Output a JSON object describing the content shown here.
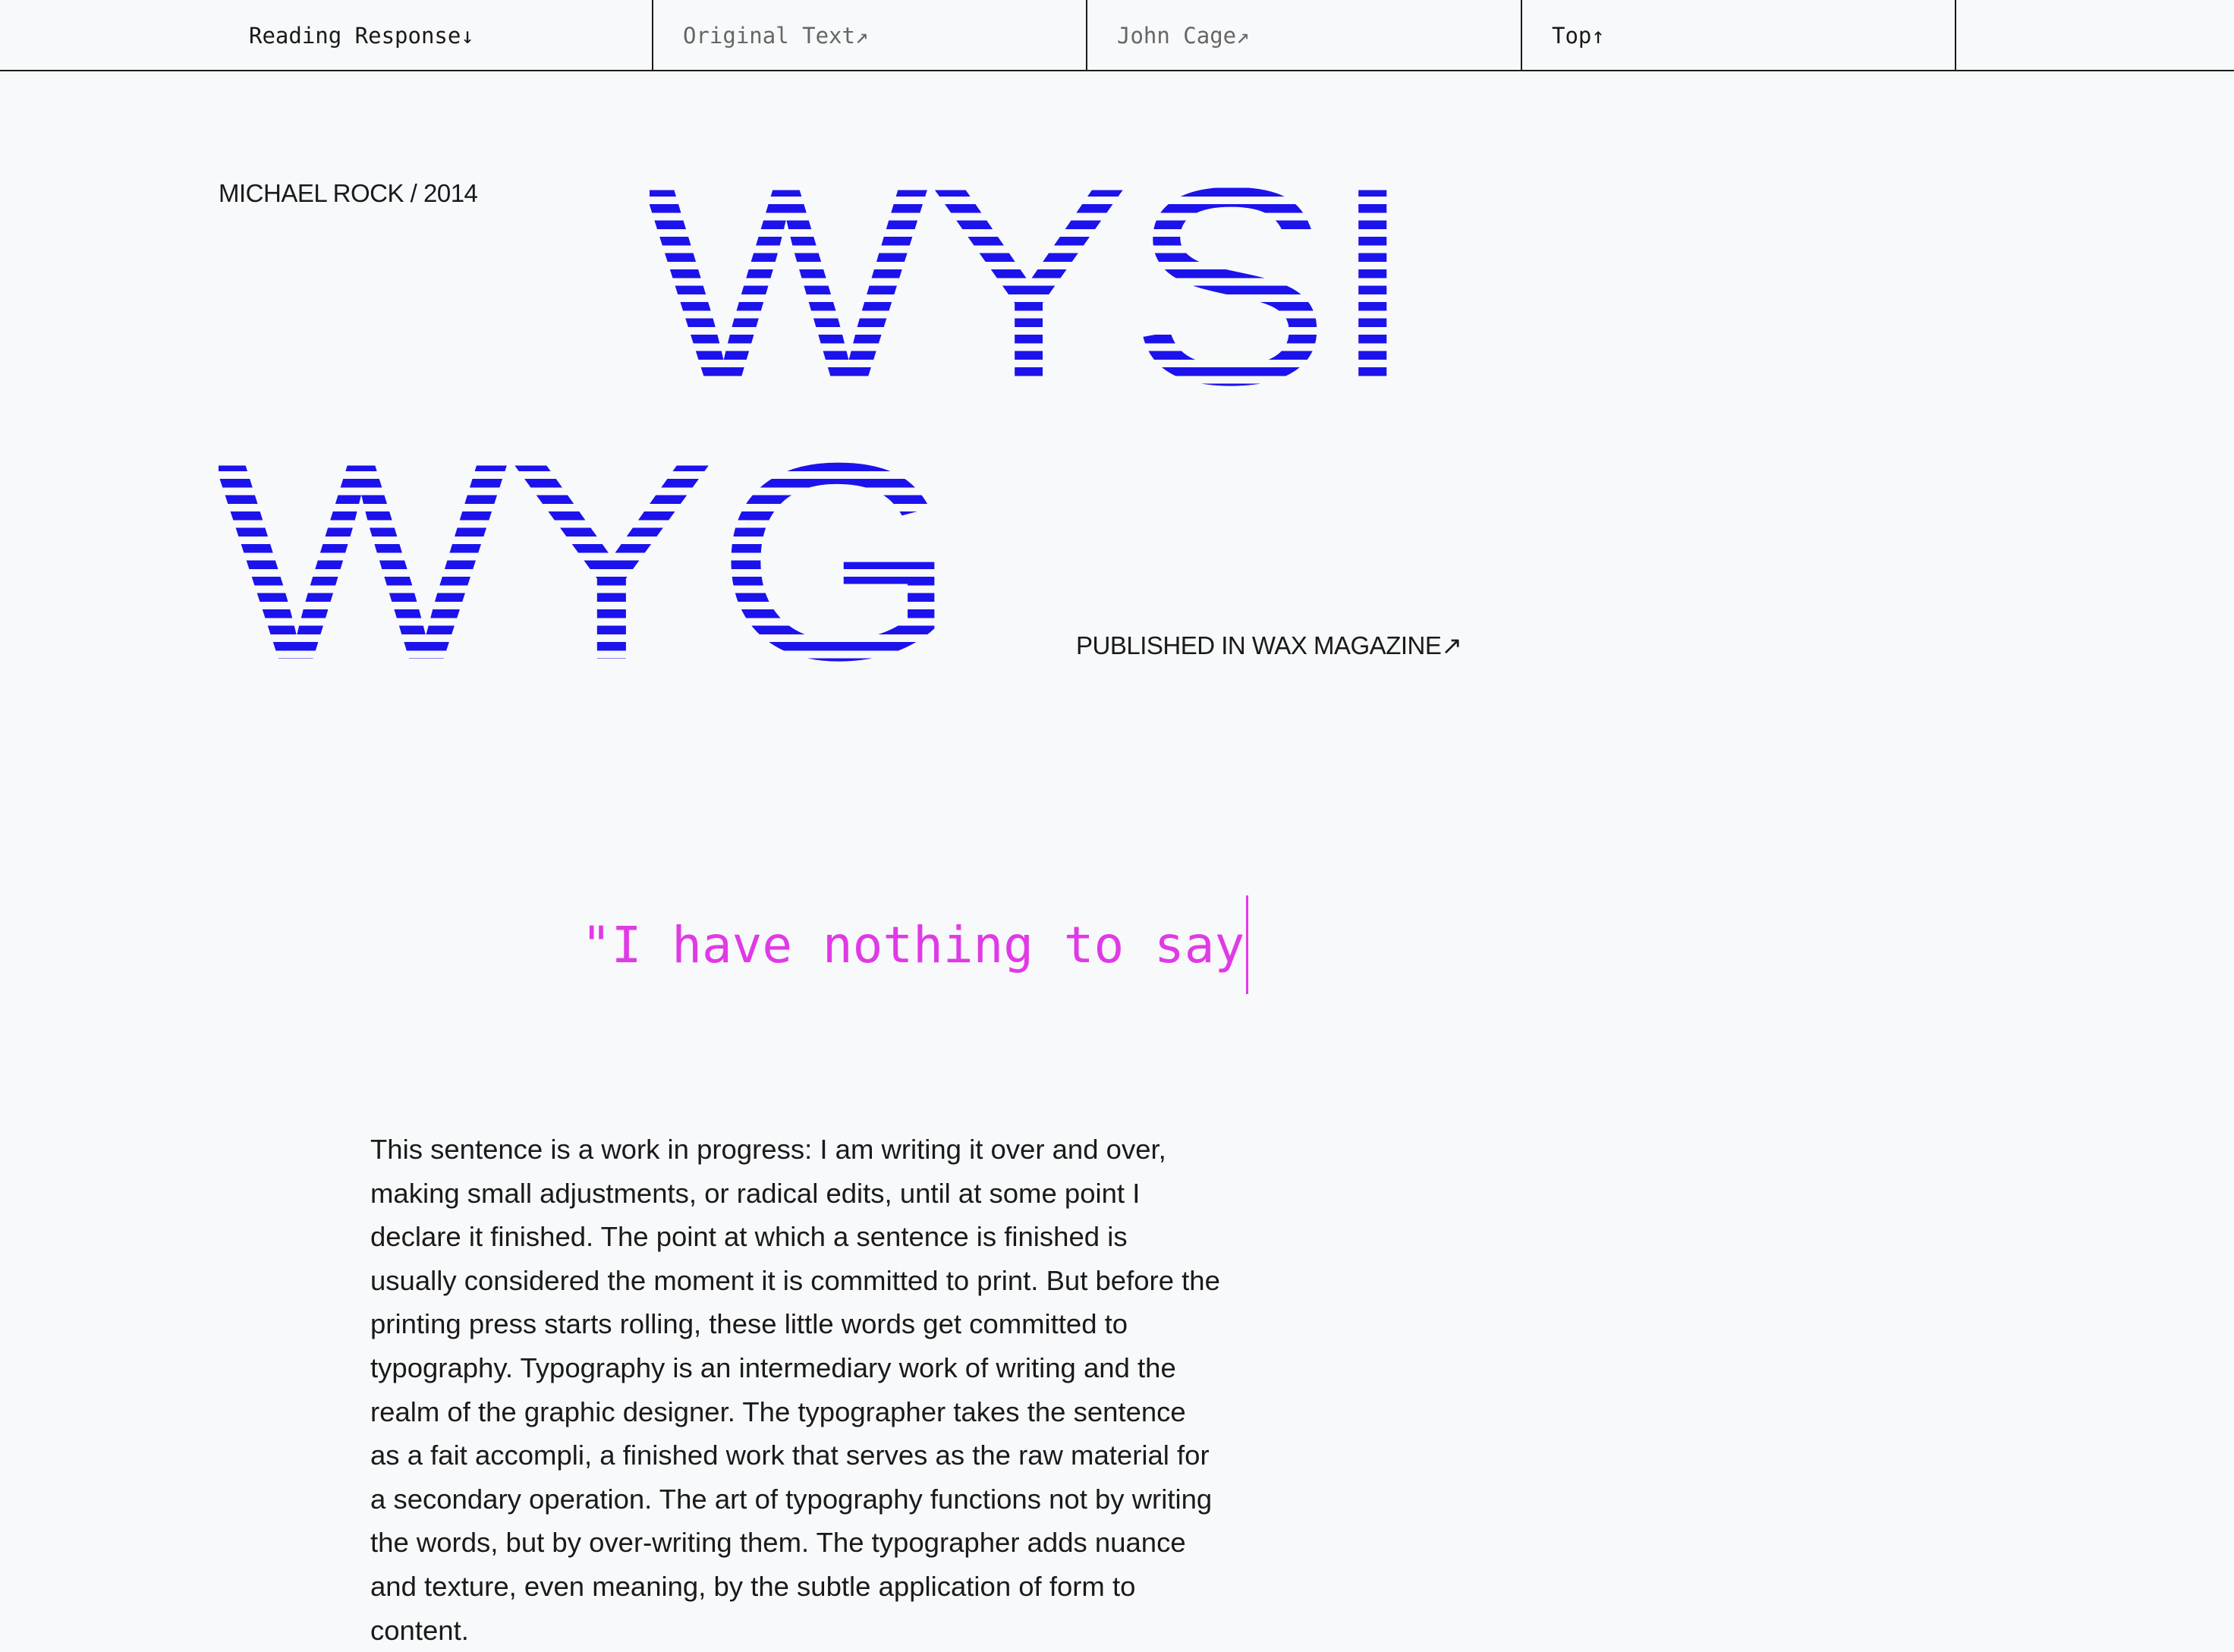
{
  "nav": {
    "items": [
      {
        "label": "Reading Response↓"
      },
      {
        "label": "Original Text↗"
      },
      {
        "label": "John Cage↗"
      },
      {
        "label": "Top↑"
      }
    ]
  },
  "header": {
    "byline": "MICHAEL ROCK / 2014",
    "title_line1": "WYSI",
    "title_line2": "WYG",
    "published": "PUBLISHED IN WAX MAGAZINE↗"
  },
  "quote": {
    "text": "\"I have nothing to say"
  },
  "article": {
    "paragraph": "This sentence is a work in progress: I am writing it over and over, making small adjustments, or radical edits, until at some point I declare it finished. The point at which a sentence is finished is usually considered the moment it is committed to print. But before the printing press starts rolling, these little words get committed to typography. Typography is an intermediary work of writing and the realm of the graphic designer. The typographer takes the sentence as a fait accompli, a finished work that serves as the raw material for a secondary operation. The art of typography functions not by writing the words, but by over-writing them. The typographer adds nuance and texture, even meaning, by the subtle application of form to content."
  },
  "colors": {
    "title": "#1c12ec",
    "quote": "#e03ae6",
    "text": "#1a1a1a",
    "background": "#f8f9fa"
  }
}
